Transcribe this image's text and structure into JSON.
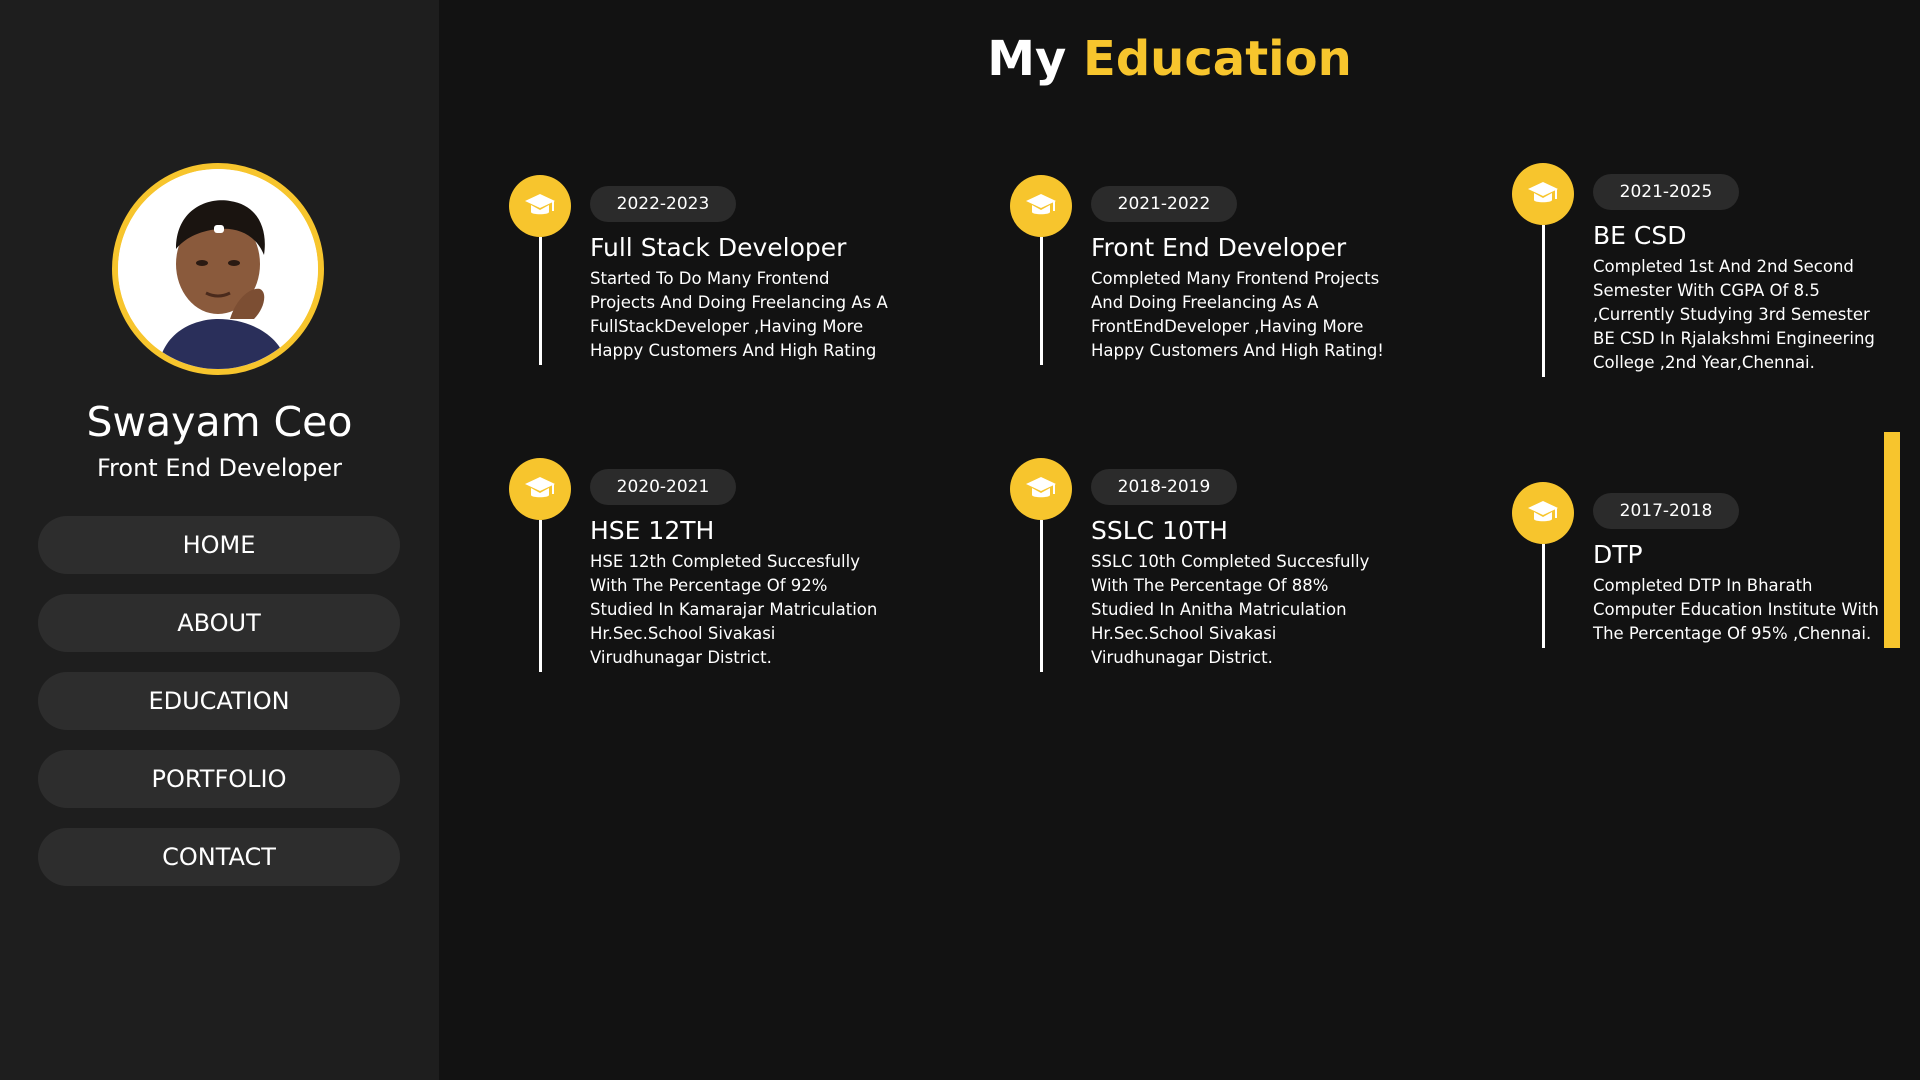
{
  "profile": {
    "name": "Swayam Ceo",
    "role": "Front End Developer"
  },
  "nav": {
    "items": [
      {
        "label": "HOME"
      },
      {
        "label": "ABOUT"
      },
      {
        "label": "EDUCATION"
      },
      {
        "label": "PORTFOLIO"
      },
      {
        "label": "CONTACT"
      }
    ]
  },
  "section": {
    "title_part1": "My",
    "title_part2": "Education"
  },
  "education": [
    {
      "year": "2022-2023",
      "title": "Full Stack Developer",
      "desc": "Started To Do Many Frontend Projects And Doing Freelancing As A FullStackDeveloper ,Having More Happy Customers And High Rating",
      "icon": "graduation-cap-icon"
    },
    {
      "year": "2021-2022",
      "title": "Front End Developer",
      "desc": "Completed Many Frontend Projects And Doing Freelancing As A FrontEndDeveloper ,Having More Happy Customers And High Rating!",
      "icon": "graduation-cap-icon"
    },
    {
      "year": "2021-2025",
      "title": "BE CSD",
      "desc": "Completed 1st And 2nd Second Semester With CGPA Of 8.5 ,Currently Studying 3rd Semester BE CSD In Rjalakshmi Engineering College ,2nd Year,Chennai.",
      "icon": "graduation-cap-icon"
    },
    {
      "year": "2020-2021",
      "title": "HSE 12TH",
      "desc": "HSE 12th Completed Succesfully With The Percentage Of 92% Studied In Kamarajar Matriculation Hr.Sec.School Sivakasi Virudhunagar District.",
      "icon": "graduation-cap-icon"
    },
    {
      "year": "2018-2019",
      "title": "SSLC 10TH",
      "desc": "SSLC 10th Completed Succesfully With The Percentage Of 88% Studied In Anitha Matriculation Hr.Sec.School Sivakasi Virudhunagar District.",
      "icon": "graduation-cap-icon"
    },
    {
      "year": "2017-2018",
      "title": "DTP",
      "desc": "Completed DTP In Bharath Computer Education Institute With The Percentage Of 95% ,Chennai.",
      "icon": "graduation-cap-icon"
    }
  ],
  "colors": {
    "accent": "#f7c52d",
    "background": "#121212",
    "sidebar": "#1e1e1e"
  }
}
